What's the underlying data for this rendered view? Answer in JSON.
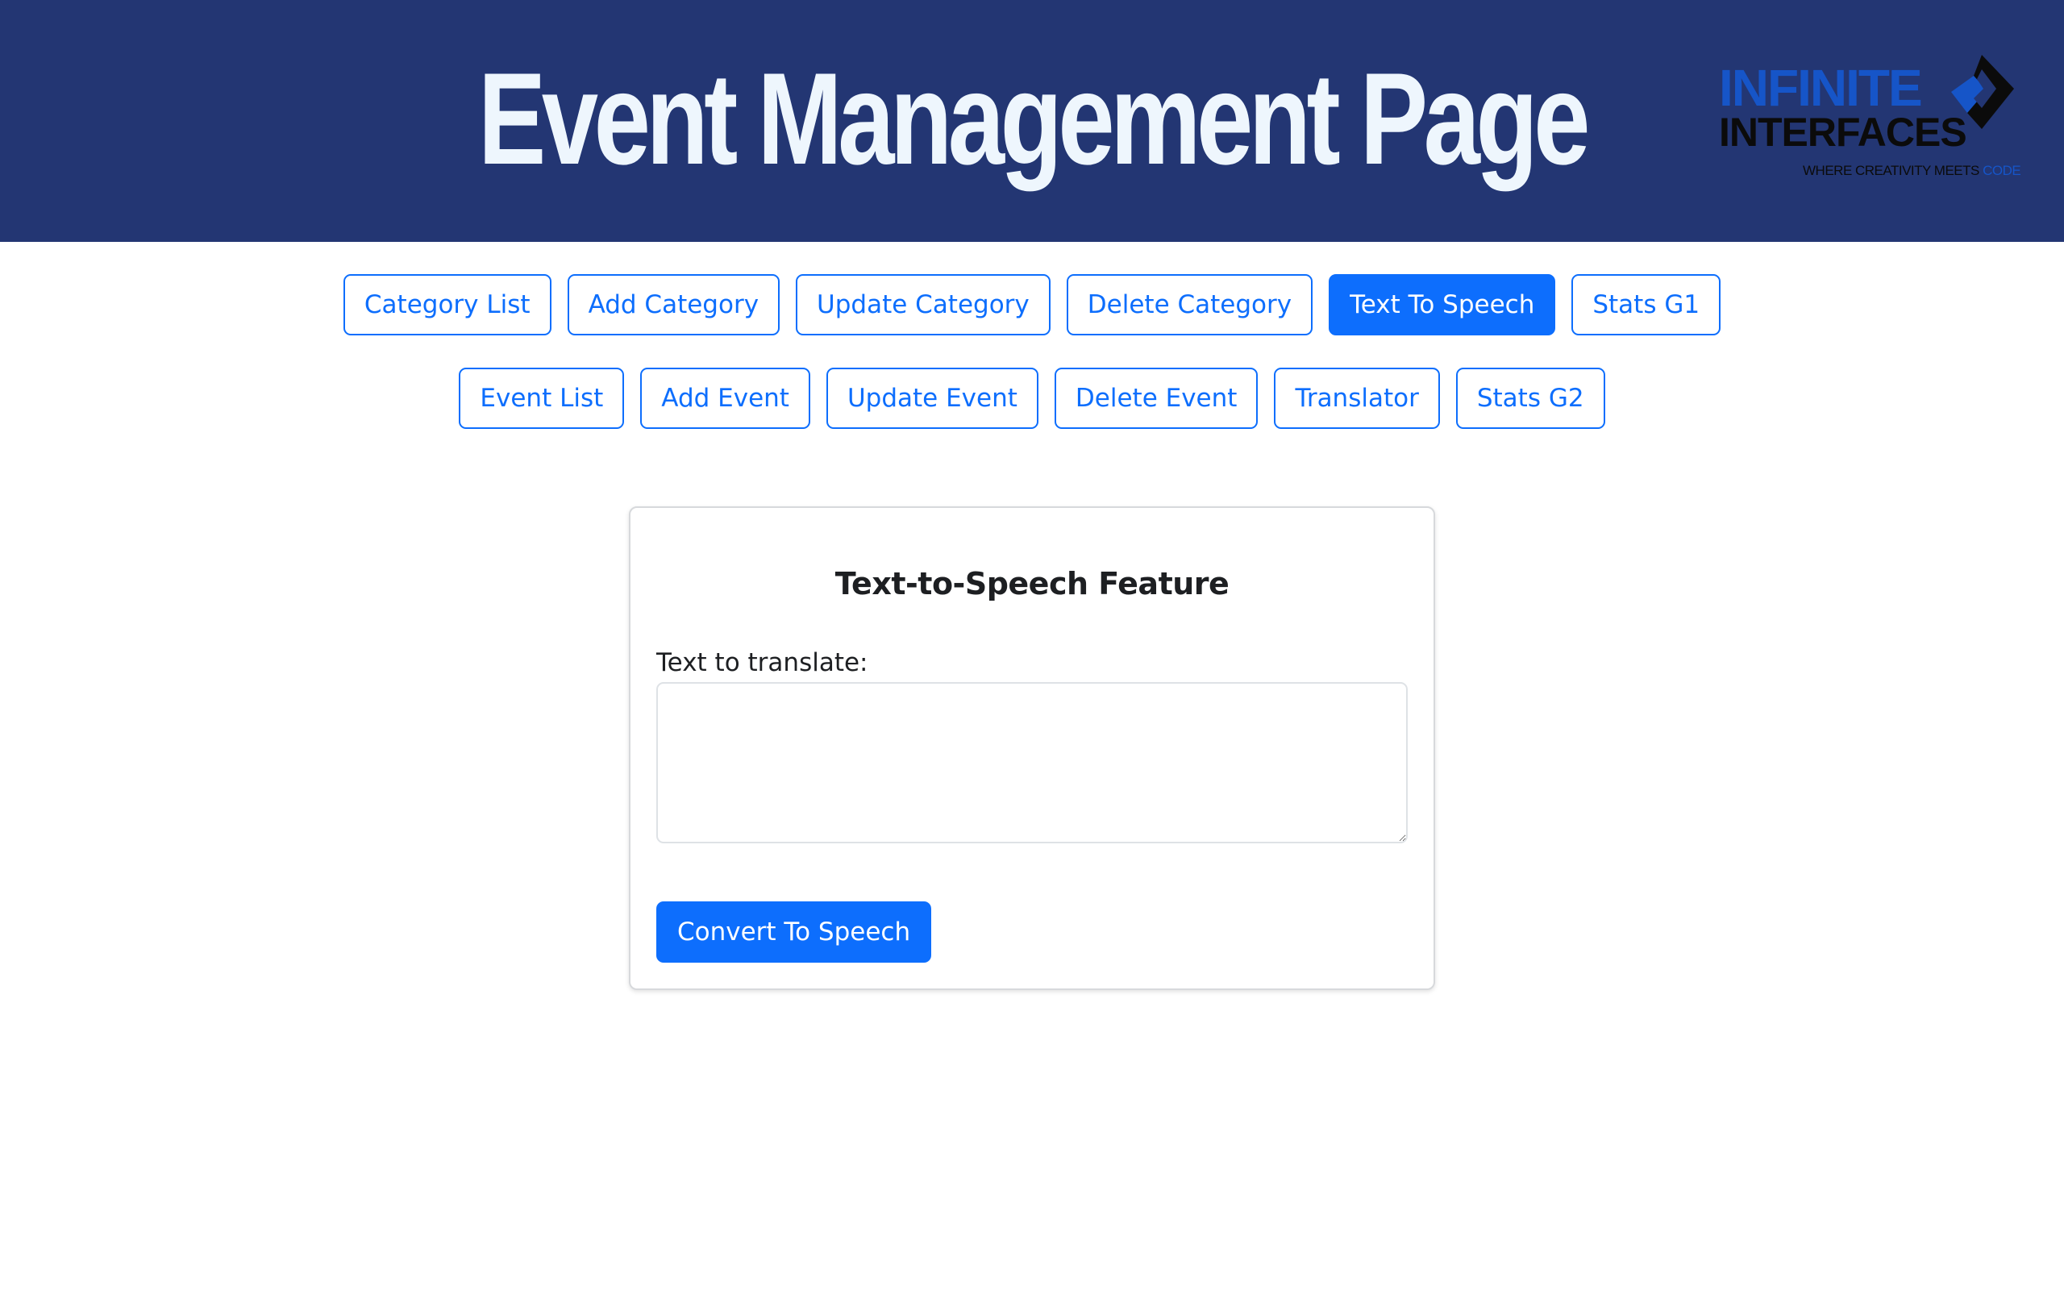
{
  "header": {
    "title": "Event Management Page",
    "background_color": "#233673",
    "logo": {
      "word_1": "INFINITE",
      "word_2": "INTERFACES",
      "tagline_prefix": "WHERE CREATIVITY MEETS",
      "tagline_highlight": "CODE",
      "icon": "diamond-logo-mark-icon"
    }
  },
  "nav": {
    "row_1": [
      {
        "label": "Category List",
        "active": false
      },
      {
        "label": "Add Category",
        "active": false
      },
      {
        "label": "Update Category",
        "active": false
      },
      {
        "label": "Delete Category",
        "active": false
      },
      {
        "label": "Text To Speech",
        "active": true
      },
      {
        "label": "Stats G1",
        "active": false
      }
    ],
    "row_2": [
      {
        "label": "Event List",
        "active": false
      },
      {
        "label": "Add Event",
        "active": false
      },
      {
        "label": "Update Event",
        "active": false
      },
      {
        "label": "Delete Event",
        "active": false
      },
      {
        "label": "Translator",
        "active": false
      },
      {
        "label": "Stats G2",
        "active": false
      }
    ],
    "accent_color": "#0d6efd"
  },
  "tts": {
    "title": "Text-to-Speech Feature",
    "field_label": "Text to translate:",
    "field_value": "",
    "submit_label": "Convert To Speech"
  }
}
